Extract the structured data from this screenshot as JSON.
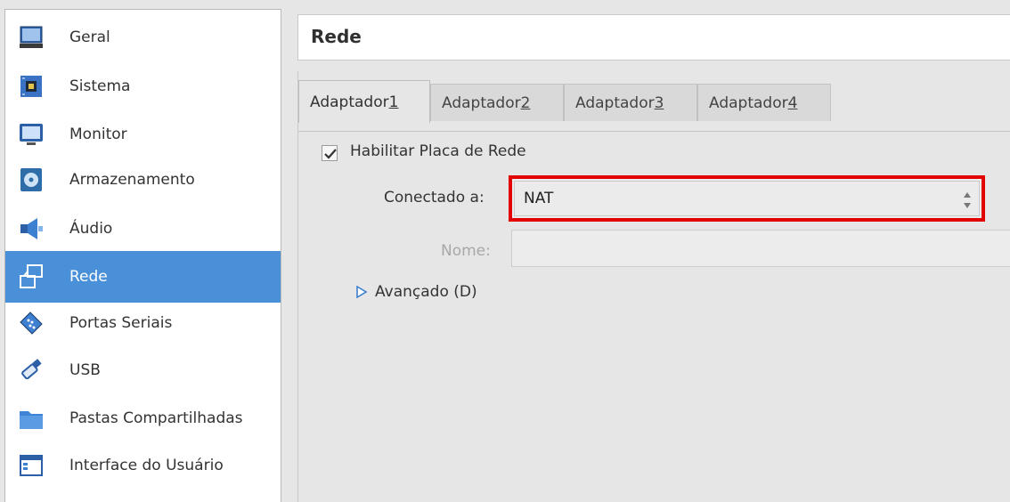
{
  "sidebar": {
    "items": [
      {
        "label": "Geral",
        "icon": "monitor-screen-icon"
      },
      {
        "label": "Sistema",
        "icon": "chip-icon"
      },
      {
        "label": "Monitor",
        "icon": "display-icon"
      },
      {
        "label": "Armazenamento",
        "icon": "disk-icon"
      },
      {
        "label": "Áudio",
        "icon": "speaker-icon"
      },
      {
        "label": "Rede",
        "icon": "network-icon",
        "selected": true
      },
      {
        "label": "Portas Seriais",
        "icon": "serial-port-icon"
      },
      {
        "label": "USB",
        "icon": "usb-icon"
      },
      {
        "label": "Pastas Compartilhadas",
        "icon": "shared-folder-icon"
      },
      {
        "label": "Interface do Usuário",
        "icon": "user-interface-icon"
      }
    ],
    "selected_color": "#4a90d9"
  },
  "header": {
    "title": "Rede"
  },
  "tabs": [
    {
      "prefix": "Adaptador ",
      "key": "1",
      "active": true
    },
    {
      "prefix": "Adaptador ",
      "key": "2"
    },
    {
      "prefix": "Adaptador ",
      "key": "3"
    },
    {
      "prefix": "Adaptador ",
      "key": "4"
    }
  ],
  "adapter": {
    "enable_label": "Habilitar Placa de Rede",
    "enabled": true,
    "attached_label": "Conectado a:",
    "attached_value": "NAT",
    "name_label": "Nome:",
    "name_value": "",
    "advanced_label": "Avançado (D)"
  },
  "colors": {
    "highlight": "#e30000",
    "accent": "#4a90d9"
  }
}
